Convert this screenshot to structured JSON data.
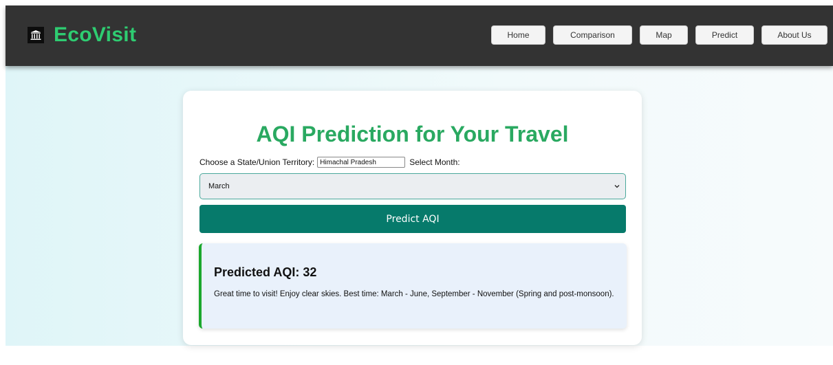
{
  "header": {
    "brand": "EcoVisit",
    "logo_icon": "monument-icon",
    "nav": [
      "Home",
      "Comparison",
      "Map",
      "Predict",
      "About Us"
    ]
  },
  "main": {
    "title": "AQI Prediction for Your Travel",
    "state_label": "Choose a State/Union Territory:",
    "state_value": "Himachal Pradesh",
    "month_label": "Select Month:",
    "month_selected": "March",
    "predict_button": "Predict AQI",
    "result": {
      "heading": "Predicted AQI: 32",
      "message": "Great time to visit! Enjoy clear skies. Best time: March - June, September - November (Spring and post-monsoon)."
    }
  },
  "colors": {
    "brand": "#2ecc71",
    "title": "#2aa961",
    "button": "#067a6b",
    "result_border": "#1ba82d"
  }
}
